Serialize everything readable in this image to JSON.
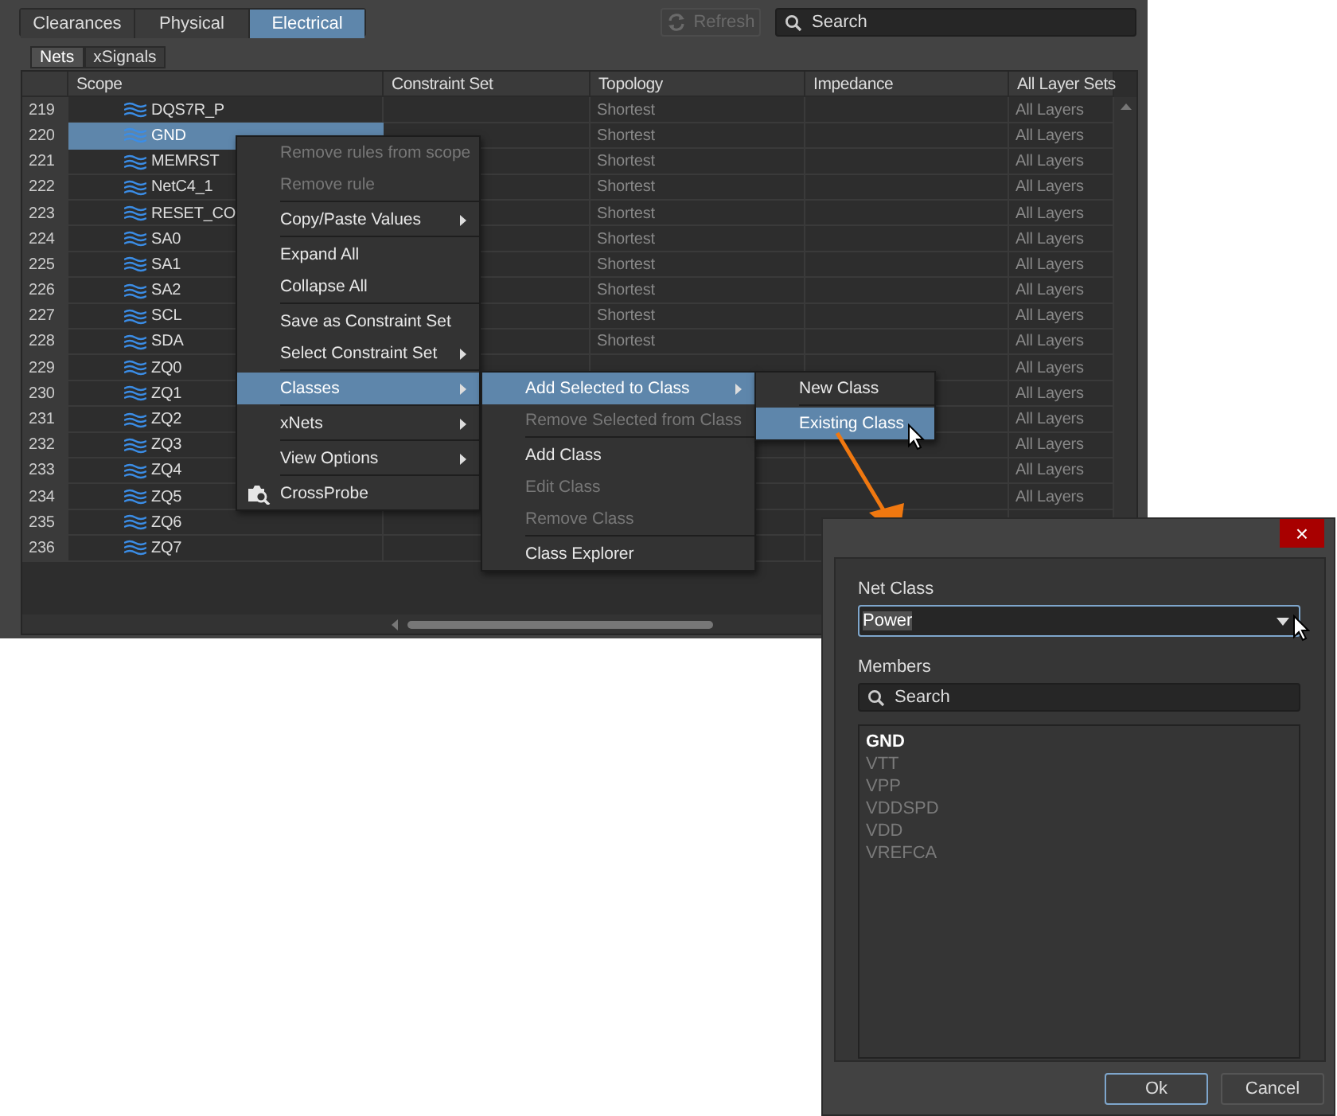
{
  "tabs": [
    {
      "label": "Clearances",
      "selected": false
    },
    {
      "label": "Physical",
      "selected": false
    },
    {
      "label": "Electrical",
      "selected": true
    }
  ],
  "refresh_button": {
    "label": "Refresh",
    "disabled": true
  },
  "search": {
    "placeholder": "Search"
  },
  "subtabs": [
    {
      "label": "Nets",
      "selected": true
    },
    {
      "label": "xSignals",
      "selected": false
    }
  ],
  "table": {
    "columns": [
      "Scope",
      "Constraint Set",
      "Topology",
      "Impedance",
      "All Layer Sets"
    ],
    "rows": [
      {
        "number": "219",
        "scope": "DQS7R_P",
        "topology": "Shortest",
        "layer_set": "All Layers",
        "selected": false
      },
      {
        "number": "220",
        "scope": "GND",
        "topology": "Shortest",
        "layer_set": "All Layers",
        "selected": true
      },
      {
        "number": "221",
        "scope": "MEMRST",
        "topology": "Shortest",
        "layer_set": "All Layers",
        "selected": false
      },
      {
        "number": "222",
        "scope": "NetC4_1",
        "topology": "Shortest",
        "layer_set": "All Layers",
        "selected": false
      },
      {
        "number": "223",
        "scope": "RESET_CO",
        "topology": "Shortest",
        "layer_set": "All Layers",
        "selected": false
      },
      {
        "number": "224",
        "scope": "SA0",
        "topology": "Shortest",
        "layer_set": "All Layers",
        "selected": false
      },
      {
        "number": "225",
        "scope": "SA1",
        "topology": "Shortest",
        "layer_set": "All Layers",
        "selected": false
      },
      {
        "number": "226",
        "scope": "SA2",
        "topology": "Shortest",
        "layer_set": "All Layers",
        "selected": false
      },
      {
        "number": "227",
        "scope": "SCL",
        "topology": "Shortest",
        "layer_set": "All Layers",
        "selected": false
      },
      {
        "number": "228",
        "scope": "SDA",
        "topology": "Shortest",
        "layer_set": "All Layers",
        "selected": false
      },
      {
        "number": "229",
        "scope": "ZQ0",
        "layer_set": "All Layers",
        "selected": false
      },
      {
        "number": "230",
        "scope": "ZQ1",
        "layer_set": "All Layers",
        "selected": false
      },
      {
        "number": "231",
        "scope": "ZQ2",
        "layer_set": "All Layers",
        "selected": false
      },
      {
        "number": "232",
        "scope": "ZQ3",
        "layer_set": "All Layers",
        "selected": false
      },
      {
        "number": "233",
        "scope": "ZQ4",
        "layer_set": "All Layers",
        "selected": false
      },
      {
        "number": "234",
        "scope": "ZQ5",
        "layer_set": "All Layers",
        "selected": false
      },
      {
        "number": "235",
        "scope": "ZQ6",
        "selected": false
      },
      {
        "number": "236",
        "scope": "ZQ7",
        "selected": false
      }
    ]
  },
  "menus": [
    {
      "items": [
        {
          "kind": "item",
          "label": "Remove rules from scope",
          "disabled": true,
          "selected": false,
          "arrow": false
        },
        {
          "kind": "item",
          "label": "Remove rule",
          "disabled": true,
          "selected": false,
          "arrow": false
        },
        {
          "kind": "separator"
        },
        {
          "kind": "item",
          "label": "Copy/Paste Values",
          "disabled": false,
          "selected": false,
          "arrow": true
        },
        {
          "kind": "separator"
        },
        {
          "kind": "item",
          "label": "Expand All",
          "disabled": false,
          "selected": false,
          "arrow": false
        },
        {
          "kind": "item",
          "label": "Collapse All",
          "disabled": false,
          "selected": false,
          "arrow": false
        },
        {
          "kind": "separator"
        },
        {
          "kind": "item",
          "label": "Save as Constraint Set",
          "disabled": false,
          "selected": false,
          "arrow": false
        },
        {
          "kind": "item",
          "label": "Select Constraint Set",
          "disabled": false,
          "selected": false,
          "arrow": true
        },
        {
          "kind": "separator"
        },
        {
          "kind": "item",
          "label": "Classes",
          "disabled": false,
          "selected": true,
          "arrow": true
        },
        {
          "kind": "separator"
        },
        {
          "kind": "item",
          "label": "xNets",
          "disabled": false,
          "selected": false,
          "arrow": true
        },
        {
          "kind": "separator"
        },
        {
          "kind": "item",
          "label": "View Options",
          "disabled": false,
          "selected": false,
          "arrow": true
        },
        {
          "kind": "separator"
        },
        {
          "kind": "icon_item",
          "label": "CrossProbe",
          "disabled": false,
          "selected": false,
          "arrow": false
        }
      ]
    },
    {
      "items": [
        {
          "kind": "item",
          "label": "Add Selected to Class",
          "disabled": false,
          "selected": true,
          "arrow": true
        },
        {
          "kind": "item",
          "label": "Remove Selected from Class",
          "disabled": true,
          "selected": false,
          "arrow": false
        },
        {
          "kind": "separator"
        },
        {
          "kind": "item",
          "label": "Add Class",
          "disabled": false,
          "selected": false,
          "arrow": false
        },
        {
          "kind": "item",
          "label": "Edit Class",
          "disabled": true,
          "selected": false,
          "arrow": false
        },
        {
          "kind": "item",
          "label": "Remove Class",
          "disabled": true,
          "selected": false,
          "arrow": false
        },
        {
          "kind": "separator"
        },
        {
          "kind": "item",
          "label": "Class Explorer",
          "disabled": false,
          "selected": false,
          "arrow": false
        }
      ]
    },
    {
      "items": [
        {
          "kind": "item",
          "label": "New Class",
          "disabled": false,
          "selected": false,
          "arrow": false
        },
        {
          "kind": "separator"
        },
        {
          "kind": "item",
          "label": "Existing Class",
          "disabled": false,
          "selected": true,
          "arrow": false
        }
      ]
    }
  ],
  "dialog": {
    "close": "×",
    "net_class_label": "Net Class",
    "net_class": "Power",
    "members_label": "Members",
    "search_placeholder": "Search",
    "members": [
      {
        "name": "GND",
        "selected": true
      },
      {
        "name": "VTT",
        "selected": false
      },
      {
        "name": "VPP",
        "selected": false
      },
      {
        "name": "VDDSPD",
        "selected": false
      },
      {
        "name": "VDD",
        "selected": false
      },
      {
        "name": "VREFCA",
        "selected": false
      }
    ],
    "buttons": [
      {
        "label": "Ok",
        "default": true
      },
      {
        "label": "Cancel",
        "default": false
      }
    ]
  }
}
